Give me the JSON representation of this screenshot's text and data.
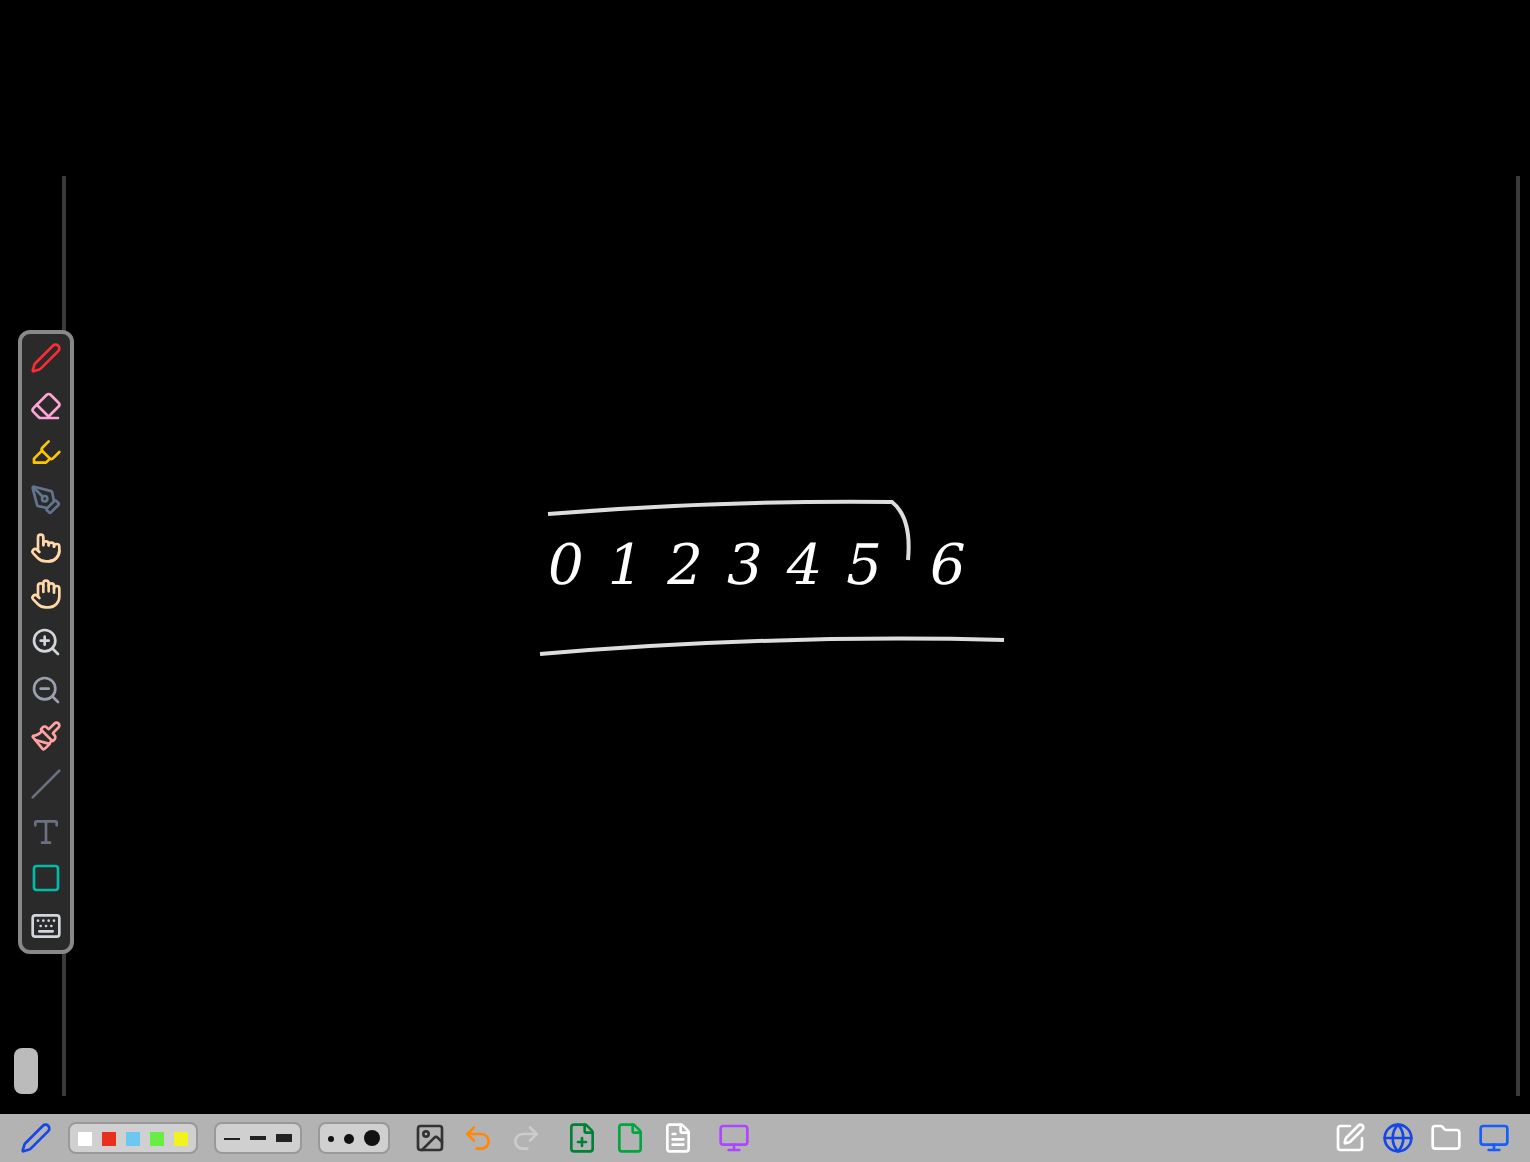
{
  "ink": {
    "digits": [
      "0",
      "1",
      "2",
      "3",
      "4",
      "5",
      "6"
    ]
  },
  "side_tools": [
    {
      "kind": "pen"
    },
    {
      "kind": "eraser"
    },
    {
      "kind": "highlighter"
    },
    {
      "kind": "pentool"
    },
    {
      "kind": "pointer"
    },
    {
      "kind": "hand"
    },
    {
      "kind": "zoomin"
    },
    {
      "kind": "zoomout"
    },
    {
      "kind": "brush"
    },
    {
      "kind": "line"
    },
    {
      "kind": "text"
    },
    {
      "kind": "shape"
    },
    {
      "kind": "keyboard"
    }
  ],
  "colors": [
    {
      "color": "#ffffff"
    },
    {
      "color": "#e8301c"
    },
    {
      "color": "#6cc8f0"
    },
    {
      "color": "#66ee44"
    },
    {
      "color": "#f2f21e"
    }
  ],
  "line_widths": [
    {
      "kind": "thin"
    },
    {
      "kind": "medium"
    },
    {
      "kind": "thick"
    }
  ],
  "dot_sizes": [
    {
      "kind": "small"
    },
    {
      "kind": "medium"
    },
    {
      "kind": "large"
    }
  ],
  "undo": {
    "disabled": false
  },
  "redo": {
    "disabled": true
  }
}
